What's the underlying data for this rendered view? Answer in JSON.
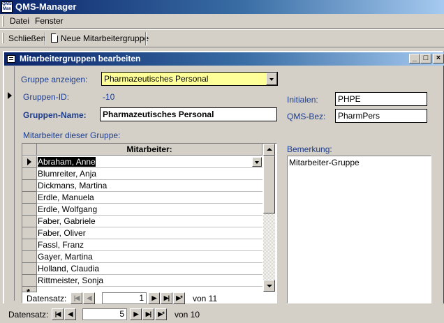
{
  "app": {
    "title": "QMS-Manager",
    "icon_text": "QMS Man"
  },
  "menu": {
    "items": [
      "Datei",
      "Fenster"
    ]
  },
  "toolbar": {
    "close_label": "Schließen",
    "new_group_label": "Neue Mitarbeitergruppe"
  },
  "window": {
    "title": "Mitarbeitergruppen bearbeiten",
    "icon": "form-icon"
  },
  "form": {
    "show_group_label": "Gruppe anzeigen:",
    "show_group_value": "Pharmazeutisches Personal",
    "group_id_label": "Gruppen-ID:",
    "group_id_value": "-10",
    "group_name_label": "Gruppen-Name:",
    "group_name_value": "Pharmazeutisches Personal",
    "initials_label": "Initialen:",
    "initials_value": "PHPE",
    "qms_label": "QMS-Bez:",
    "qms_value": "PharmPers",
    "members_label": "Mitarbeiter dieser Gruppe:",
    "remark_label": "Bemerkung:",
    "remark_value": "Mitarbeiter-Gruppe"
  },
  "members_grid": {
    "header": "Mitarbeiter:",
    "rows": [
      "Abraham, Anne",
      "Blumreiter, Anja",
      "Dickmans, Martina",
      "Erdle, Manuela",
      "Erdle, Wolfgang",
      "Faber, Gabriele",
      "Faber, Oliver",
      "Fassl, Franz",
      "Gayer, Martina",
      "Holland, Claudia",
      "Rittmeister, Sonja"
    ],
    "selected_index": 0
  },
  "subform_nav": {
    "label": "Datensatz:",
    "current": "1",
    "total_text": "von 11"
  },
  "main_nav": {
    "label": "Datensatz:",
    "current": "5",
    "total_text": "von 10"
  },
  "nav_glyphs": {
    "first": "|◀",
    "prev": "◀",
    "next": "▶",
    "last": "▶|",
    "new": "▶*"
  },
  "colors": {
    "title_bar": "#0a246a",
    "label_text": "#1c3c8c",
    "combo_bg": "#ffff99",
    "face": "#d4d0c8"
  }
}
